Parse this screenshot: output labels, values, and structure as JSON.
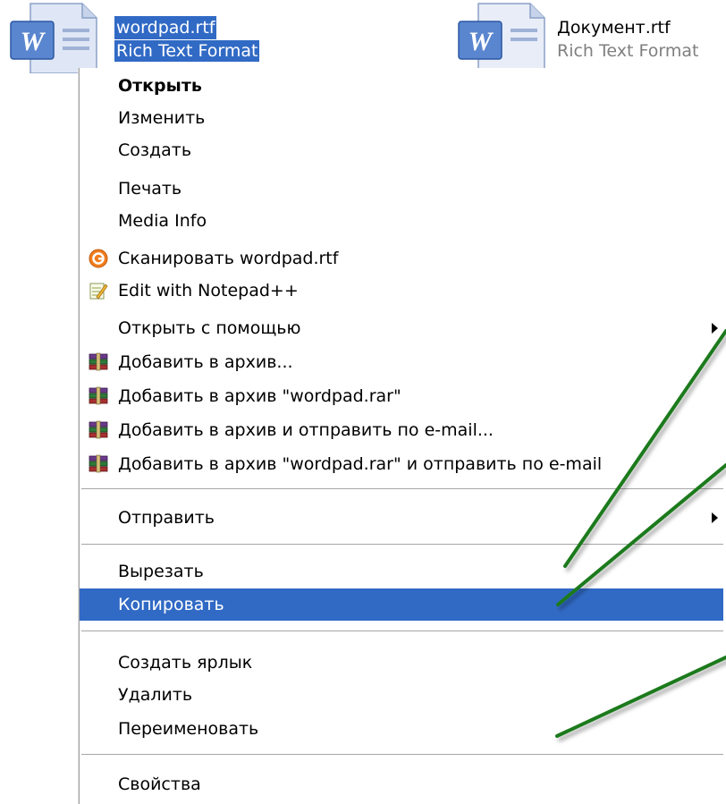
{
  "files": [
    {
      "name": "wordpad.rtf",
      "type": "Rich Text Format",
      "icon": "word-document-icon",
      "selected": true
    },
    {
      "name": "Документ.rtf",
      "type": "Rich Text Format",
      "icon": "word-document-icon",
      "selected": false
    }
  ],
  "menu": {
    "items": [
      {
        "label": "Открыть",
        "bold": true
      },
      {
        "label": "Изменить"
      },
      {
        "label": "Создать"
      },
      {
        "label": "Печать"
      },
      {
        "label": "Media Info"
      },
      {
        "label": "Сканировать wordpad.rtf",
        "icon": "antivirus-scan-icon"
      },
      {
        "label": "Edit with Notepad++",
        "icon": "notepad-plus-plus-icon"
      },
      {
        "label": "Открыть с помощью",
        "submenu": true
      },
      {
        "label": "Добавить в архив...",
        "icon": "winrar-icon"
      },
      {
        "label": "Добавить в архив \"wordpad.rar\"",
        "icon": "winrar-icon"
      },
      {
        "label": "Добавить в архив и отправить по e-mail...",
        "icon": "winrar-icon"
      },
      {
        "label": "Добавить в архив \"wordpad.rar\" и отправить по e-mail",
        "icon": "winrar-icon"
      },
      {
        "label": "Отправить",
        "submenu": true
      },
      {
        "label": "Вырезать"
      },
      {
        "label": "Копировать",
        "highlighted": true
      },
      {
        "label": "Создать ярлык"
      },
      {
        "label": "Удалить"
      },
      {
        "label": "Переименовать"
      },
      {
        "label": "Свойства"
      }
    ]
  },
  "colors": {
    "selection": "#316ac5",
    "annotation_stroke": "#1e7a1e"
  }
}
